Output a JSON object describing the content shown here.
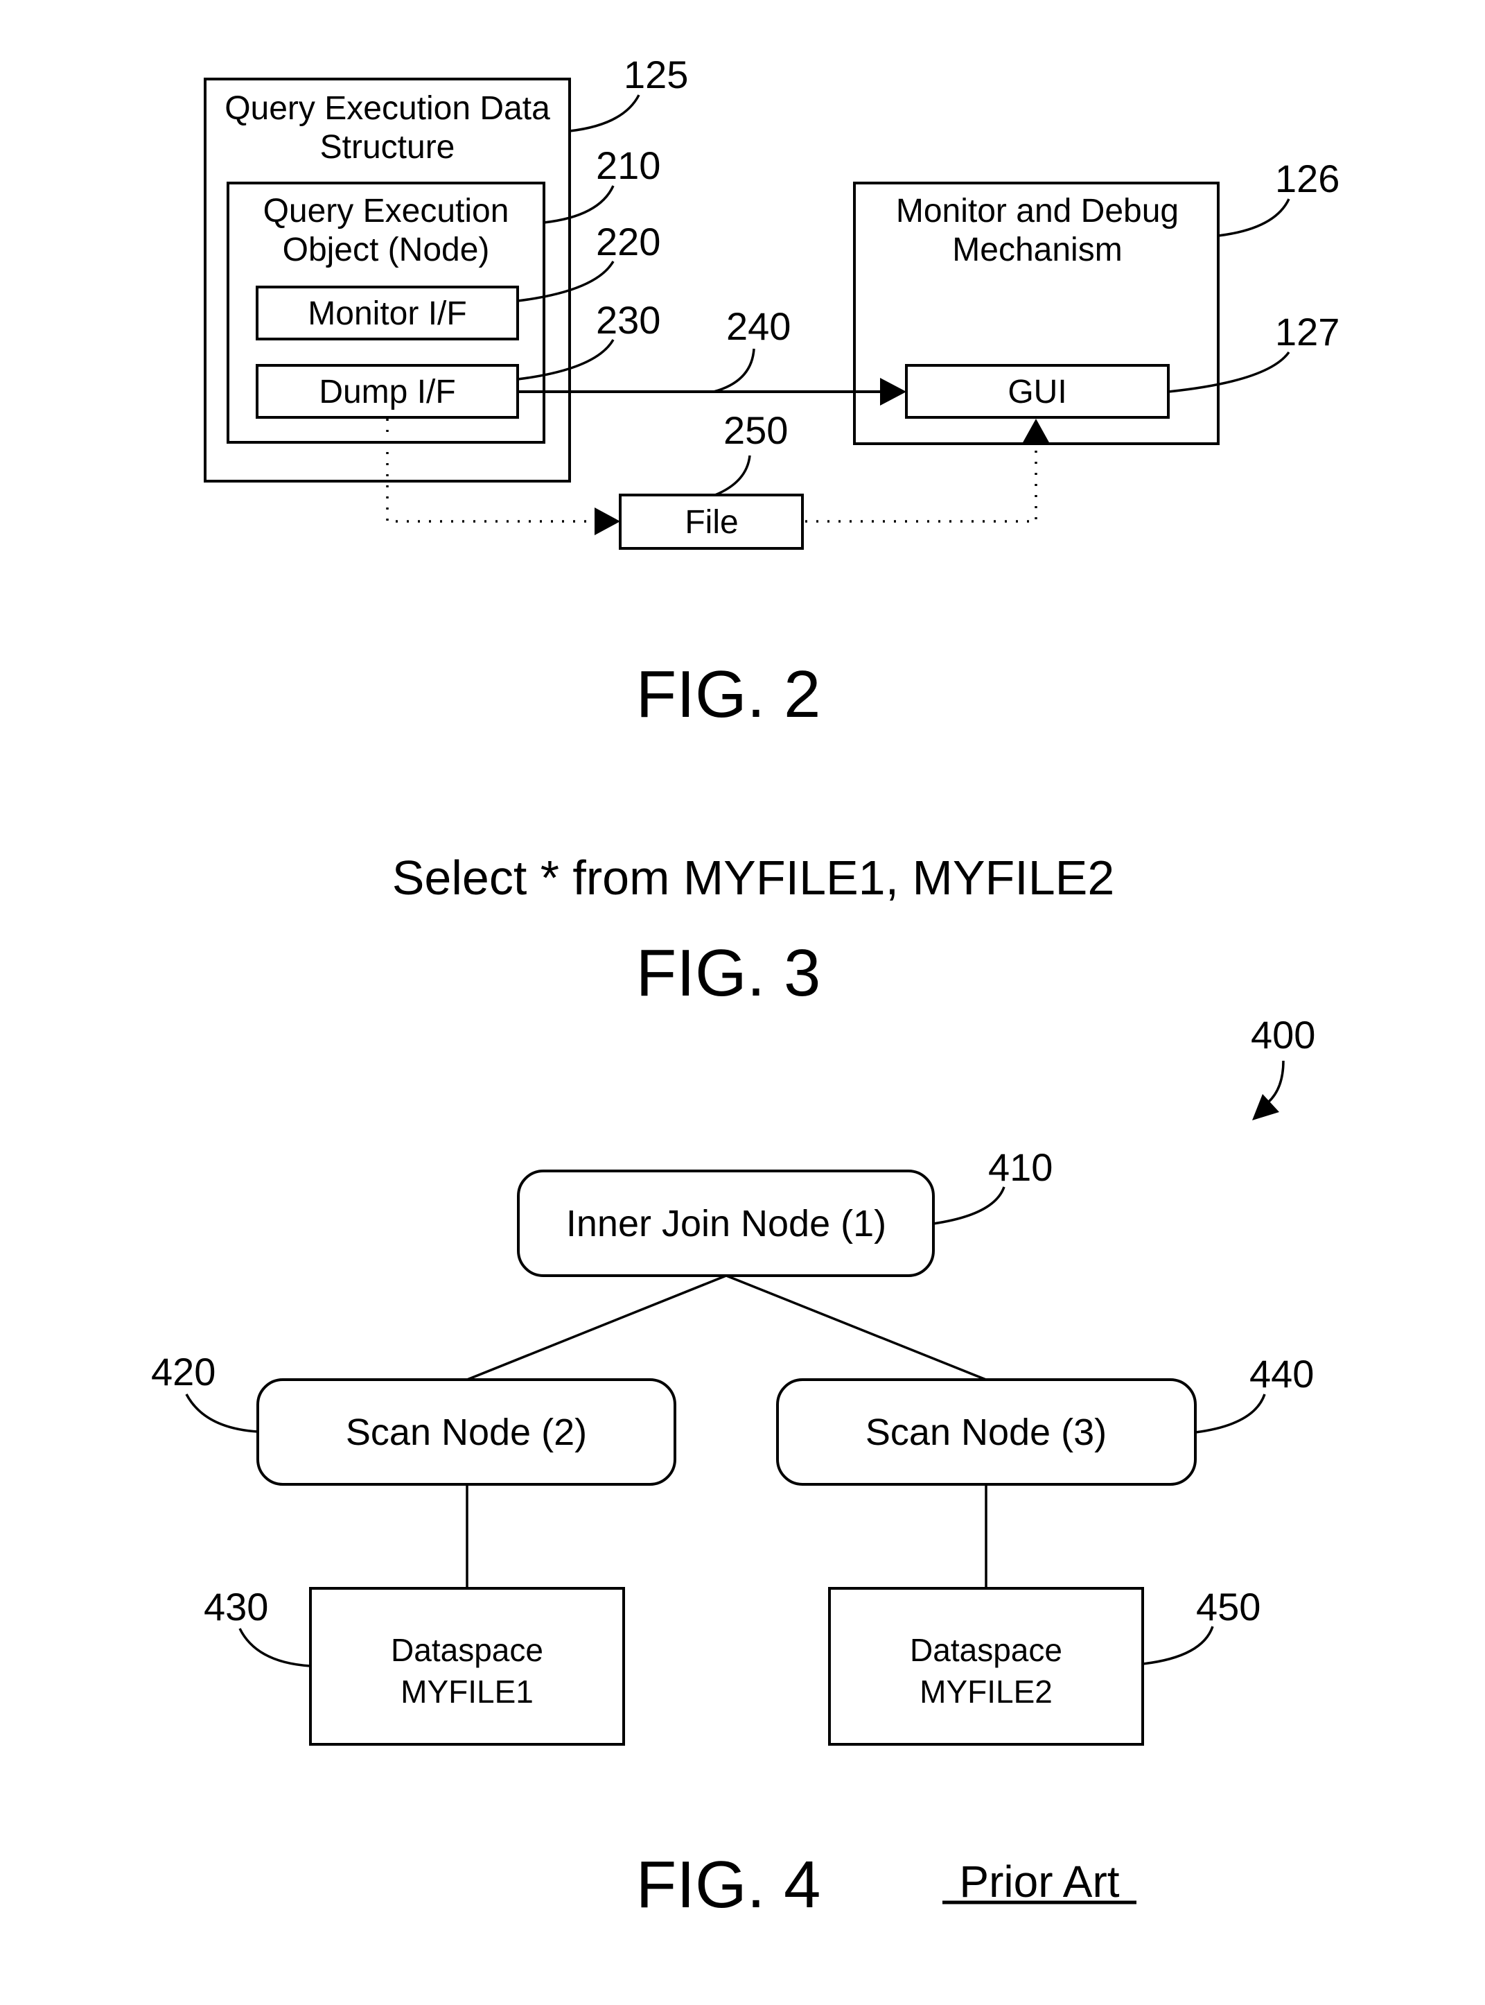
{
  "fig2": {
    "caption": "FIG. 2",
    "query_structure": {
      "line1": "Query Execution Data",
      "line2": "Structure",
      "ref": "125"
    },
    "query_object": {
      "line1": "Query Execution",
      "line2": "Object (Node)",
      "ref": "210"
    },
    "monitor_if": {
      "label": "Monitor I/F",
      "ref": "220"
    },
    "dump_if": {
      "label": "Dump I/F",
      "ref": "230"
    },
    "dump_link_ref": "240",
    "monitor_debug": {
      "line1": "Monitor and Debug",
      "line2": "Mechanism",
      "ref": "126"
    },
    "gui": {
      "label": "GUI",
      "ref": "127"
    },
    "file": {
      "label": "File",
      "ref": "250"
    }
  },
  "fig3": {
    "query": "Select * from MYFILE1, MYFILE2",
    "caption": "FIG. 3"
  },
  "fig4": {
    "caption": "FIG. 4",
    "note": "Prior Art",
    "tree_ref": "400",
    "root": {
      "label": "Inner Join Node (1)",
      "ref": "410"
    },
    "left_scan": {
      "label": "Scan Node (2)",
      "ref": "420"
    },
    "left_data": {
      "line1": "Dataspace",
      "line2": "MYFILE1",
      "ref": "430"
    },
    "right_scan": {
      "label": "Scan Node (3)",
      "ref": "440"
    },
    "right_data": {
      "line1": "Dataspace",
      "line2": "MYFILE2",
      "ref": "450"
    }
  }
}
